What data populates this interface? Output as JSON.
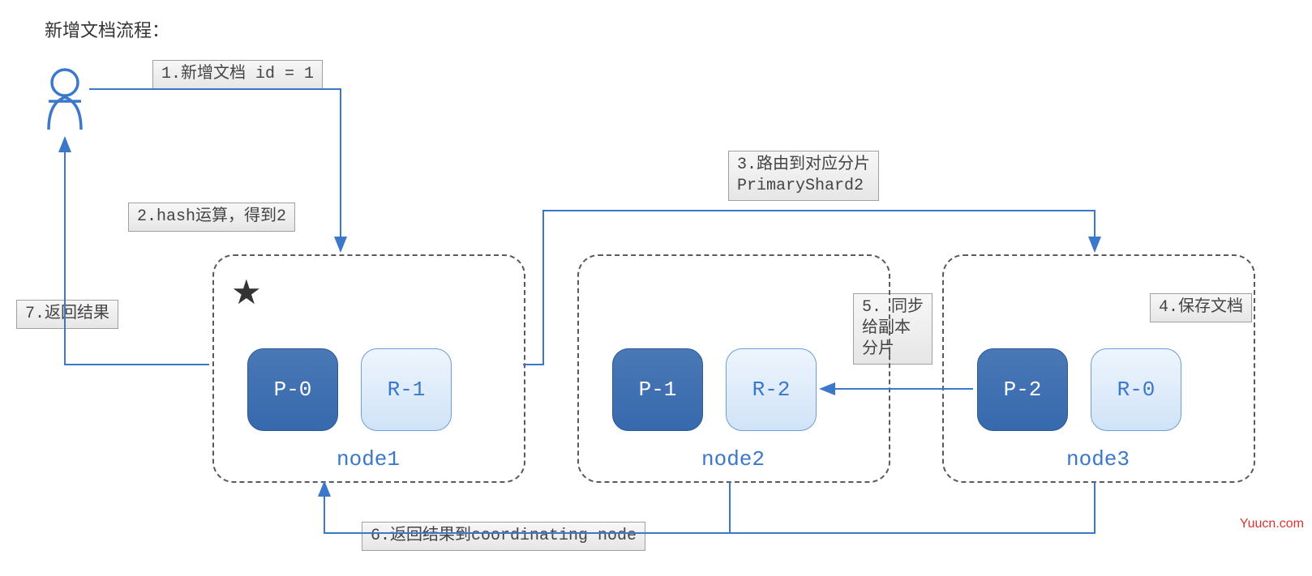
{
  "title": "新增文档流程：",
  "steps": {
    "s1": "1.新增文档 id = 1",
    "s2": "2.hash运算，得到2",
    "s3": "3.路由到对应分片\nPrimaryShard2",
    "s4": "4.保存文档",
    "s5": "5. 同步\n给副本\n分片",
    "s6": "6.返回结果到coordinating node",
    "s7": "7.返回结果"
  },
  "nodes": {
    "n1": "node1",
    "n2": "node2",
    "n3": "node3"
  },
  "shards": {
    "p0": "P-0",
    "r1": "R-1",
    "p1": "P-1",
    "r2": "R-2",
    "p2": "P-2",
    "r0": "R-0"
  },
  "watermark": "Yuucn.com"
}
